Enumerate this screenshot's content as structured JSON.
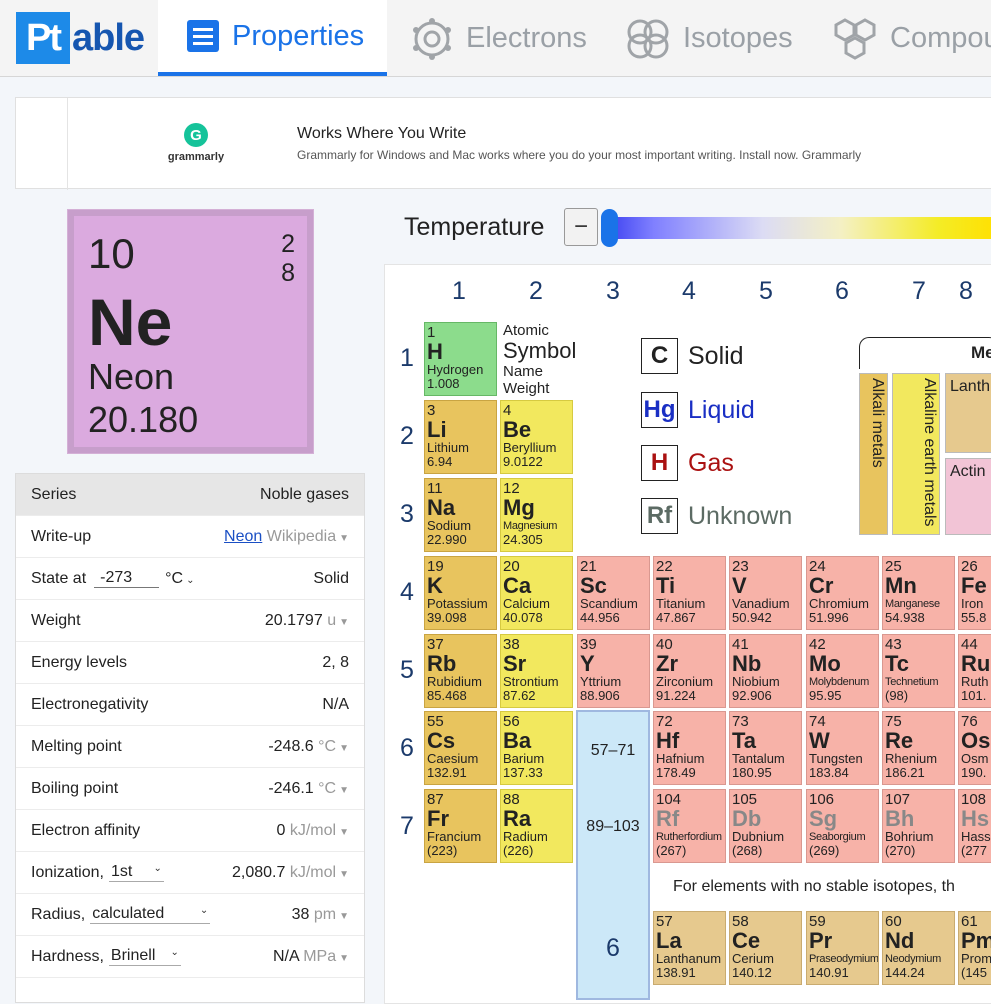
{
  "nav": {
    "logo_pt": "Pt",
    "logo_able": "able",
    "tabs": [
      {
        "label": "Properties"
      },
      {
        "label": "Electrons"
      },
      {
        "label": "Isotopes"
      },
      {
        "label": "Compou"
      }
    ]
  },
  "ad": {
    "brand": "grammarly",
    "brand_glyph": "G",
    "title": "Works Where You Write",
    "text": "Grammarly for Windows and Mac works where you do your most important writing. Install now. Grammarly"
  },
  "element": {
    "number": "10",
    "shell_1": "2",
    "shell_2": "8",
    "symbol": "Ne",
    "name": "Neon",
    "weight": "20.180",
    "color": "#dbaadf"
  },
  "properties": {
    "series_label": "Series",
    "series_value": "Noble gases",
    "writeup_label": "Write-up",
    "writeup_link": "Neon",
    "writeup_source": "Wikipedia",
    "state_label": "State at",
    "state_temp": "-273",
    "state_unit": "°C",
    "state_value": "Solid",
    "weight_label": "Weight",
    "weight_value": "20.1797",
    "weight_unit": "u",
    "energy_label": "Energy levels",
    "energy_value": "2, 8",
    "eneg_label": "Electronegativity",
    "eneg_value": "N/A",
    "melt_label": "Melting point",
    "melt_value": "-248.6",
    "melt_unit": "°C",
    "boil_label": "Boiling point",
    "boil_value": "-246.1",
    "boil_unit": "°C",
    "affinity_label": "Electron affinity",
    "affinity_value": "0",
    "affinity_unit": "kJ/mol",
    "ion_label": "Ionization,",
    "ion_select": "1st",
    "ion_value": "2,080.7",
    "ion_unit": "kJ/mol",
    "radius_label": "Radius,",
    "radius_select": "calculated",
    "radius_value": "38",
    "radius_unit": "pm",
    "hard_label": "Hardness,",
    "hard_select": "Brinell",
    "hard_value": "N/A",
    "hard_unit": "MPa"
  },
  "temperature": {
    "label": "Temperature",
    "minus": "−"
  },
  "table": {
    "groups": [
      "1",
      "2",
      "3",
      "4",
      "5",
      "6",
      "7",
      "8"
    ],
    "periods": [
      "1",
      "2",
      "3",
      "4",
      "5",
      "6",
      "7"
    ],
    "legend": {
      "number": "1",
      "symbol": "Symbol",
      "name": "Name",
      "weight": "Weight",
      "atomic": "Atomic"
    },
    "states": [
      {
        "sym": "C",
        "label": "Solid"
      },
      {
        "sym": "Hg",
        "label": "Liquid"
      },
      {
        "sym": "H",
        "label": "Gas"
      },
      {
        "sym": "Rf",
        "label": "Unknown"
      }
    ],
    "series_header": "Me",
    "series_labels": [
      "Alkali metals",
      "Alkaline earth metals",
      "Lanth",
      "Actin"
    ],
    "fblock": [
      "57–71",
      "89–103",
      "6"
    ],
    "note": "For elements with no stable isotopes, th",
    "elements": [
      {
        "n": "1",
        "s": "H",
        "nm": "Hydrogen",
        "w": "1.008"
      },
      {
        "n": "3",
        "s": "Li",
        "nm": "Lithium",
        "w": "6.94"
      },
      {
        "n": "4",
        "s": "Be",
        "nm": "Beryllium",
        "w": "9.0122"
      },
      {
        "n": "11",
        "s": "Na",
        "nm": "Sodium",
        "w": "22.990"
      },
      {
        "n": "12",
        "s": "Mg",
        "nm": "Magnesium",
        "w": "24.305"
      },
      {
        "n": "19",
        "s": "K",
        "nm": "Potassium",
        "w": "39.098"
      },
      {
        "n": "20",
        "s": "Ca",
        "nm": "Calcium",
        "w": "40.078"
      },
      {
        "n": "21",
        "s": "Sc",
        "nm": "Scandium",
        "w": "44.956"
      },
      {
        "n": "22",
        "s": "Ti",
        "nm": "Titanium",
        "w": "47.867"
      },
      {
        "n": "23",
        "s": "V",
        "nm": "Vanadium",
        "w": "50.942"
      },
      {
        "n": "24",
        "s": "Cr",
        "nm": "Chromium",
        "w": "51.996"
      },
      {
        "n": "25",
        "s": "Mn",
        "nm": "Manganese",
        "w": "54.938"
      },
      {
        "n": "26",
        "s": "Fe",
        "nm": "Iron",
        "w": "55.8"
      },
      {
        "n": "37",
        "s": "Rb",
        "nm": "Rubidium",
        "w": "85.468"
      },
      {
        "n": "38",
        "s": "Sr",
        "nm": "Strontium",
        "w": "87.62"
      },
      {
        "n": "39",
        "s": "Y",
        "nm": "Yttrium",
        "w": "88.906"
      },
      {
        "n": "40",
        "s": "Zr",
        "nm": "Zirconium",
        "w": "91.224"
      },
      {
        "n": "41",
        "s": "Nb",
        "nm": "Niobium",
        "w": "92.906"
      },
      {
        "n": "42",
        "s": "Mo",
        "nm": "Molybdenum",
        "w": "95.95"
      },
      {
        "n": "43",
        "s": "Tc",
        "nm": "Technetium",
        "w": "(98)"
      },
      {
        "n": "44",
        "s": "Ru",
        "nm": "Ruth",
        "w": "101."
      },
      {
        "n": "55",
        "s": "Cs",
        "nm": "Caesium",
        "w": "132.91"
      },
      {
        "n": "56",
        "s": "Ba",
        "nm": "Barium",
        "w": "137.33"
      },
      {
        "n": "72",
        "s": "Hf",
        "nm": "Hafnium",
        "w": "178.49"
      },
      {
        "n": "73",
        "s": "Ta",
        "nm": "Tantalum",
        "w": "180.95"
      },
      {
        "n": "74",
        "s": "W",
        "nm": "Tungsten",
        "w": "183.84"
      },
      {
        "n": "75",
        "s": "Re",
        "nm": "Rhenium",
        "w": "186.21"
      },
      {
        "n": "76",
        "s": "Os",
        "nm": "Osm",
        "w": "190."
      },
      {
        "n": "87",
        "s": "Fr",
        "nm": "Francium",
        "w": "(223)"
      },
      {
        "n": "88",
        "s": "Ra",
        "nm": "Radium",
        "w": "(226)"
      },
      {
        "n": "104",
        "s": "Rf",
        "nm": "Rutherfordium",
        "w": "(267)"
      },
      {
        "n": "105",
        "s": "Db",
        "nm": "Dubnium",
        "w": "(268)"
      },
      {
        "n": "106",
        "s": "Sg",
        "nm": "Seaborgium",
        "w": "(269)"
      },
      {
        "n": "107",
        "s": "Bh",
        "nm": "Bohrium",
        "w": "(270)"
      },
      {
        "n": "108",
        "s": "Hs",
        "nm": "Hass",
        "w": "(277"
      },
      {
        "n": "57",
        "s": "La",
        "nm": "Lanthanum",
        "w": "138.91"
      },
      {
        "n": "58",
        "s": "Ce",
        "nm": "Cerium",
        "w": "140.12"
      },
      {
        "n": "59",
        "s": "Pr",
        "nm": "Praseodymium",
        "w": "140.91"
      },
      {
        "n": "60",
        "s": "Nd",
        "nm": "Neodymium",
        "w": "144.24"
      },
      {
        "n": "61",
        "s": "Pm",
        "nm": "Prom",
        "w": "(145"
      }
    ]
  }
}
